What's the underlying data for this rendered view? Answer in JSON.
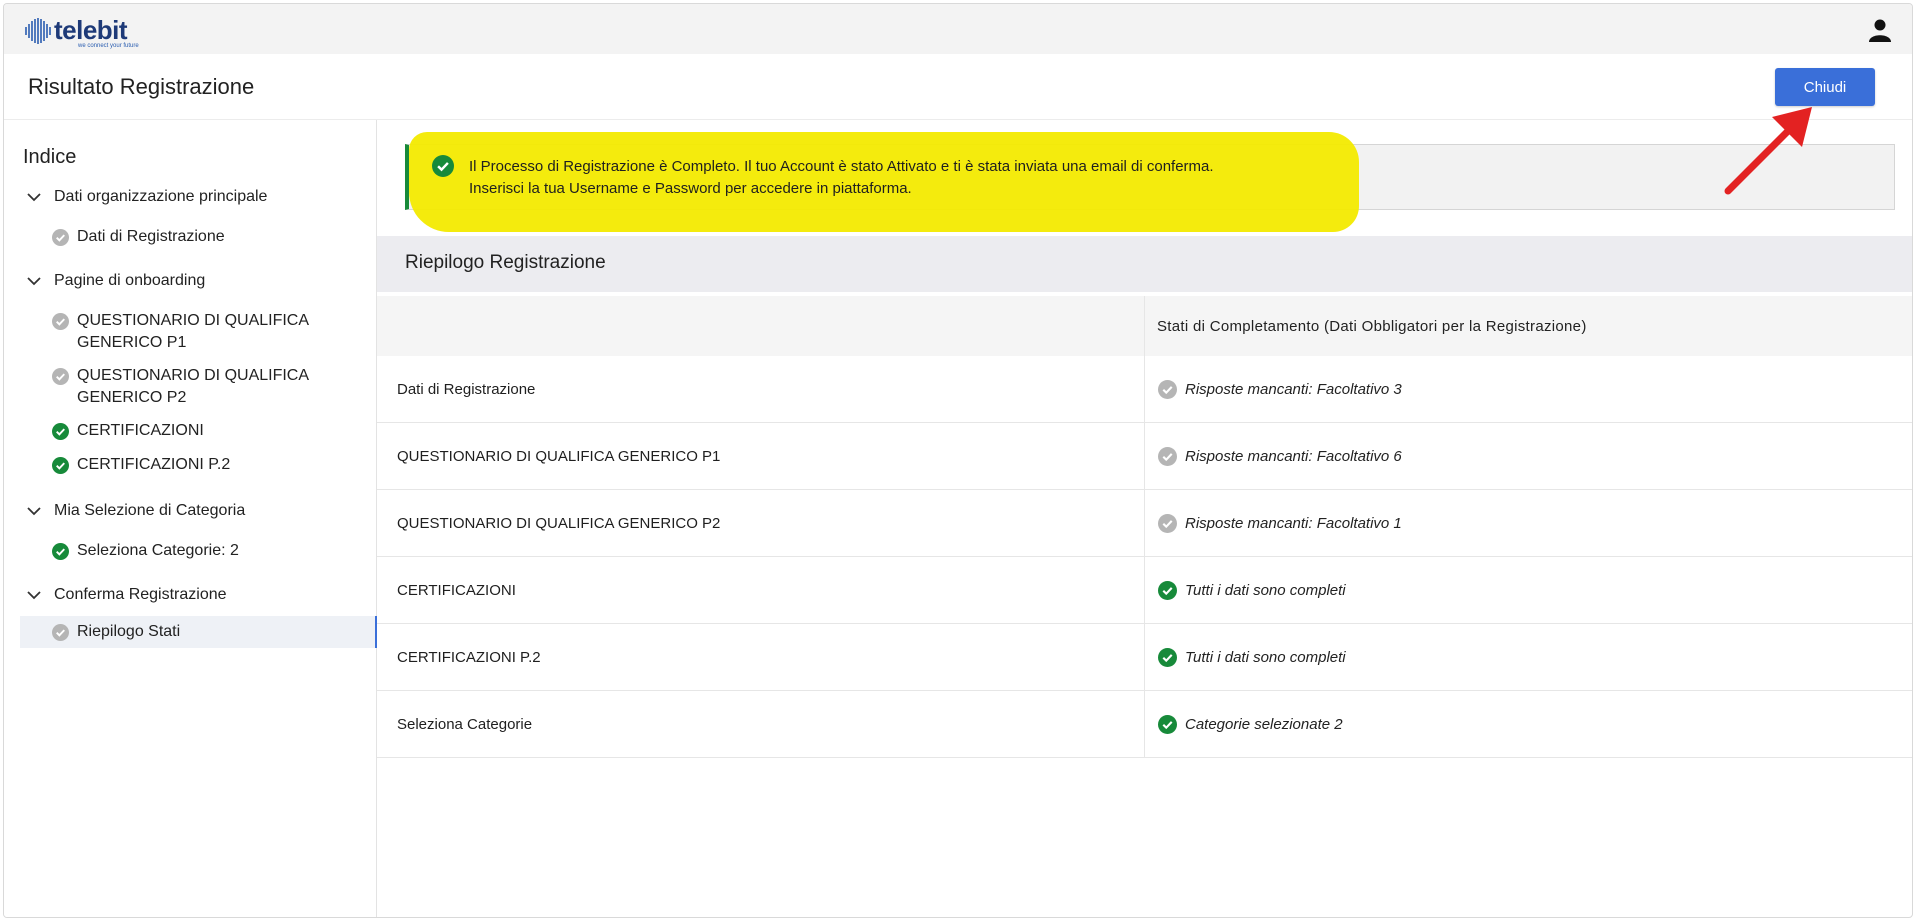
{
  "brand": {
    "name": "telebit",
    "tagline": "we connect your future"
  },
  "header": {
    "title": "Risultato Registrazione",
    "close_label": "Chiudi"
  },
  "sidebar": {
    "title": "Indice",
    "sections": [
      {
        "label": "Dati organizzazione principale",
        "items": [
          {
            "label": "Dati di Registrazione",
            "status": "pending"
          }
        ]
      },
      {
        "label": "Pagine di onboarding",
        "items": [
          {
            "label": "QUESTIONARIO DI QUALIFICA GENERICO P1",
            "status": "pending"
          },
          {
            "label": "QUESTIONARIO DI QUALIFICA GENERICO P2",
            "status": "pending"
          },
          {
            "label": "CERTIFICAZIONI",
            "status": "complete"
          },
          {
            "label": "CERTIFICAZIONI P.2",
            "status": "complete"
          }
        ]
      },
      {
        "label": "Mia Selezione di Categoria",
        "items": [
          {
            "label": "Seleziona Categorie: 2",
            "status": "complete"
          }
        ]
      },
      {
        "label": "Conferma Registrazione",
        "items": [
          {
            "label": "Riepilogo Stati",
            "status": "pending",
            "active": true
          }
        ]
      }
    ]
  },
  "notice": {
    "line1": "Il Processo di Registrazione è Completo. Il tuo Account è stato Attivato e ti è stata inviata una email di conferma.",
    "line2": "Inserisci la tua Username e Password per accedere in piattaforma."
  },
  "summary": {
    "title": "Riepilogo Registrazione",
    "columns": [
      "",
      "Stati di Completamento (Dati Obbligatori per la Registrazione)"
    ],
    "rows": [
      {
        "name": "Dati di Registrazione",
        "status": "Risposte mancanti: Facoltativo 3",
        "state": "pending"
      },
      {
        "name": "QUESTIONARIO DI QUALIFICA GENERICO P1",
        "status": "Risposte mancanti: Facoltativo 6",
        "state": "pending"
      },
      {
        "name": "QUESTIONARIO DI QUALIFICA GENERICO P2",
        "status": "Risposte mancanti: Facoltativo 1",
        "state": "pending"
      },
      {
        "name": "CERTIFICAZIONI",
        "status": "Tutti i dati sono completi",
        "state": "complete"
      },
      {
        "name": "CERTIFICAZIONI P.2",
        "status": "Tutti i dati sono completi",
        "state": "complete"
      },
      {
        "name": "Seleziona Categorie",
        "status": "Categorie selezionate 2",
        "state": "complete"
      }
    ]
  },
  "colors": {
    "accent": "#3a6fd9",
    "success": "#178a3a",
    "pending": "#b5b5b5",
    "highlight": "#f3ea00",
    "annotation_arrow": "#e32222"
  },
  "icons": {
    "user": "user-icon",
    "complete": "check-circle-icon",
    "pending": "check-circle-gray-icon",
    "section": "chevron-down-icon"
  }
}
